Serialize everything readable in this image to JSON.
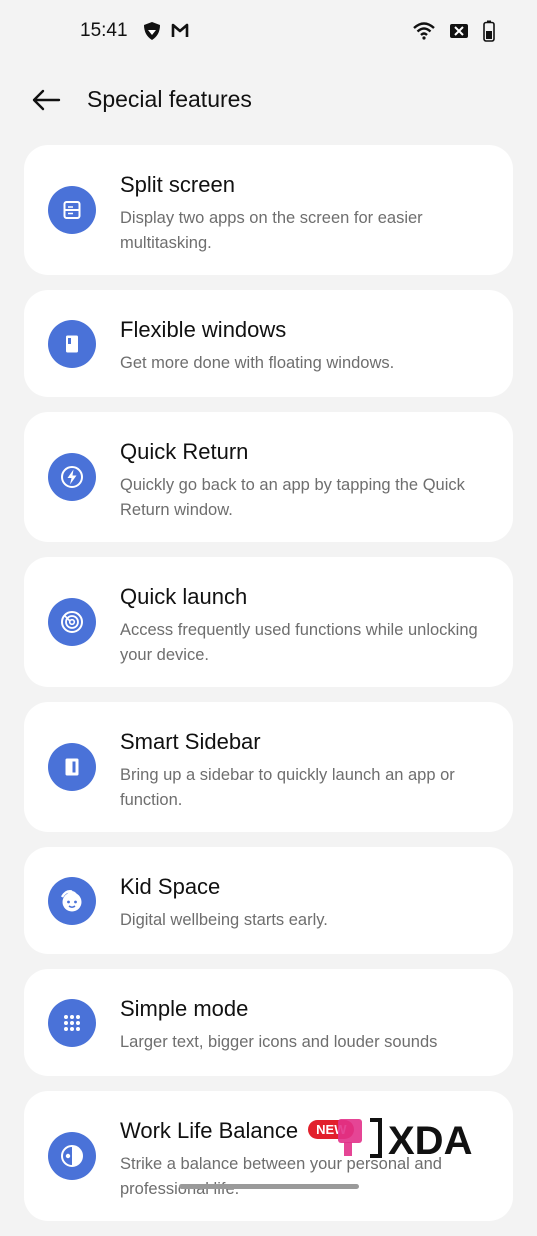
{
  "status": {
    "time": "15:41"
  },
  "header": {
    "title": "Special features"
  },
  "items": [
    {
      "title": "Split screen",
      "desc": "Display two apps on the screen for easier multitasking."
    },
    {
      "title": "Flexible windows",
      "desc": "Get more done with floating windows."
    },
    {
      "title": "Quick Return",
      "desc": "Quickly go back to an app by tapping the Quick Return window."
    },
    {
      "title": "Quick launch",
      "desc": "Access frequently used functions while unlocking your device."
    },
    {
      "title": "Smart Sidebar",
      "desc": "Bring up a sidebar to quickly launch an app or function."
    },
    {
      "title": "Kid Space",
      "desc": "Digital wellbeing starts early."
    },
    {
      "title": "Simple mode",
      "desc": "Larger text, bigger icons and louder sounds"
    },
    {
      "title": "Work Life Balance",
      "desc": "Strike a balance between your personal and professional life.",
      "badge": "NEW"
    }
  ],
  "watermark": {
    "text": "XDA"
  },
  "colors": {
    "accent": "#4a72d8",
    "background": "#f3f3f3",
    "card": "#ffffff",
    "badge": "#e2202c"
  }
}
